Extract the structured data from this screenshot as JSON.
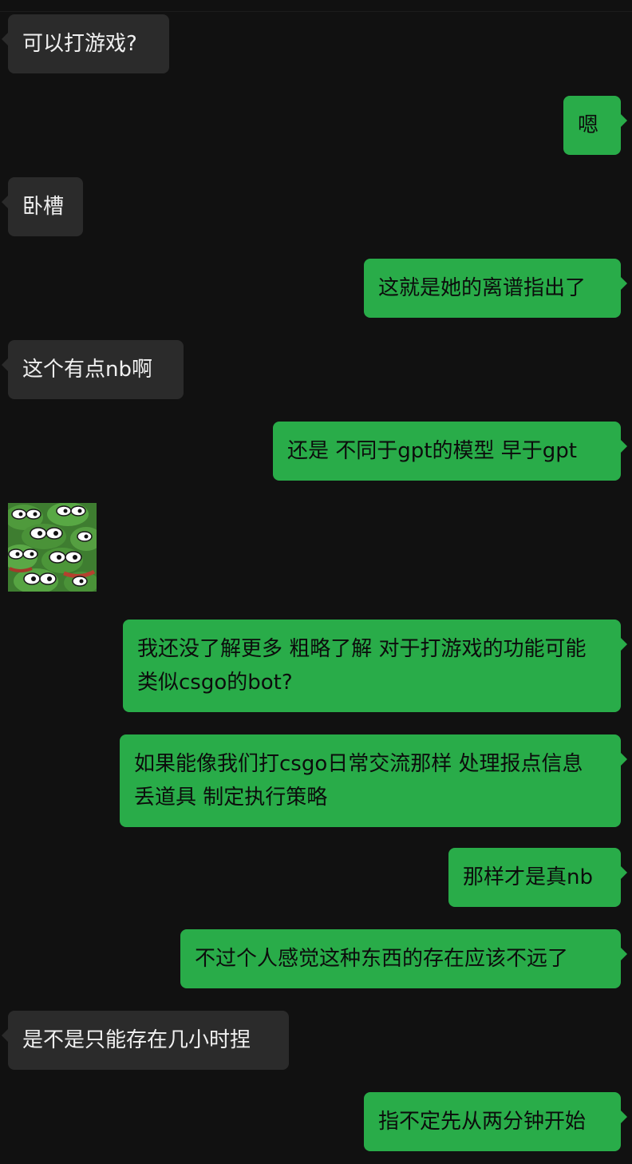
{
  "messages": [
    {
      "side": "in",
      "text": "可以打游戏?"
    },
    {
      "side": "out",
      "text": "嗯"
    },
    {
      "side": "in",
      "text": "卧槽"
    },
    {
      "side": "out",
      "text": "这就是她的离谱指出了"
    },
    {
      "side": "in",
      "text": "这个有点nb啊"
    },
    {
      "side": "out",
      "text": "还是 不同于gpt的模型 早于gpt"
    },
    {
      "side": "in",
      "type": "sticker",
      "icon": "pepe-frogs-sticker"
    },
    {
      "side": "out",
      "text": "我还没了解更多 粗略了解 对于打游戏的功能可能 类似csgo的bot?"
    },
    {
      "side": "out",
      "text": "如果能像我们打csgo日常交流那样 处理报点信息 丢道具 制定执行策略"
    },
    {
      "side": "out",
      "text": "那样才是真nb"
    },
    {
      "side": "out",
      "text": "不过个人感觉这种东西的存在应该不远了"
    },
    {
      "side": "in",
      "text": "是不是只能存在几小时捏"
    },
    {
      "side": "out",
      "text": "指不定先从两分钟开始"
    }
  ],
  "colors": {
    "background": "#111111",
    "incoming_bubble": "#2b2b2b",
    "outgoing_bubble": "#29ac49",
    "incoming_text": "#f0f0f0",
    "outgoing_text": "#0c0c0c"
  }
}
